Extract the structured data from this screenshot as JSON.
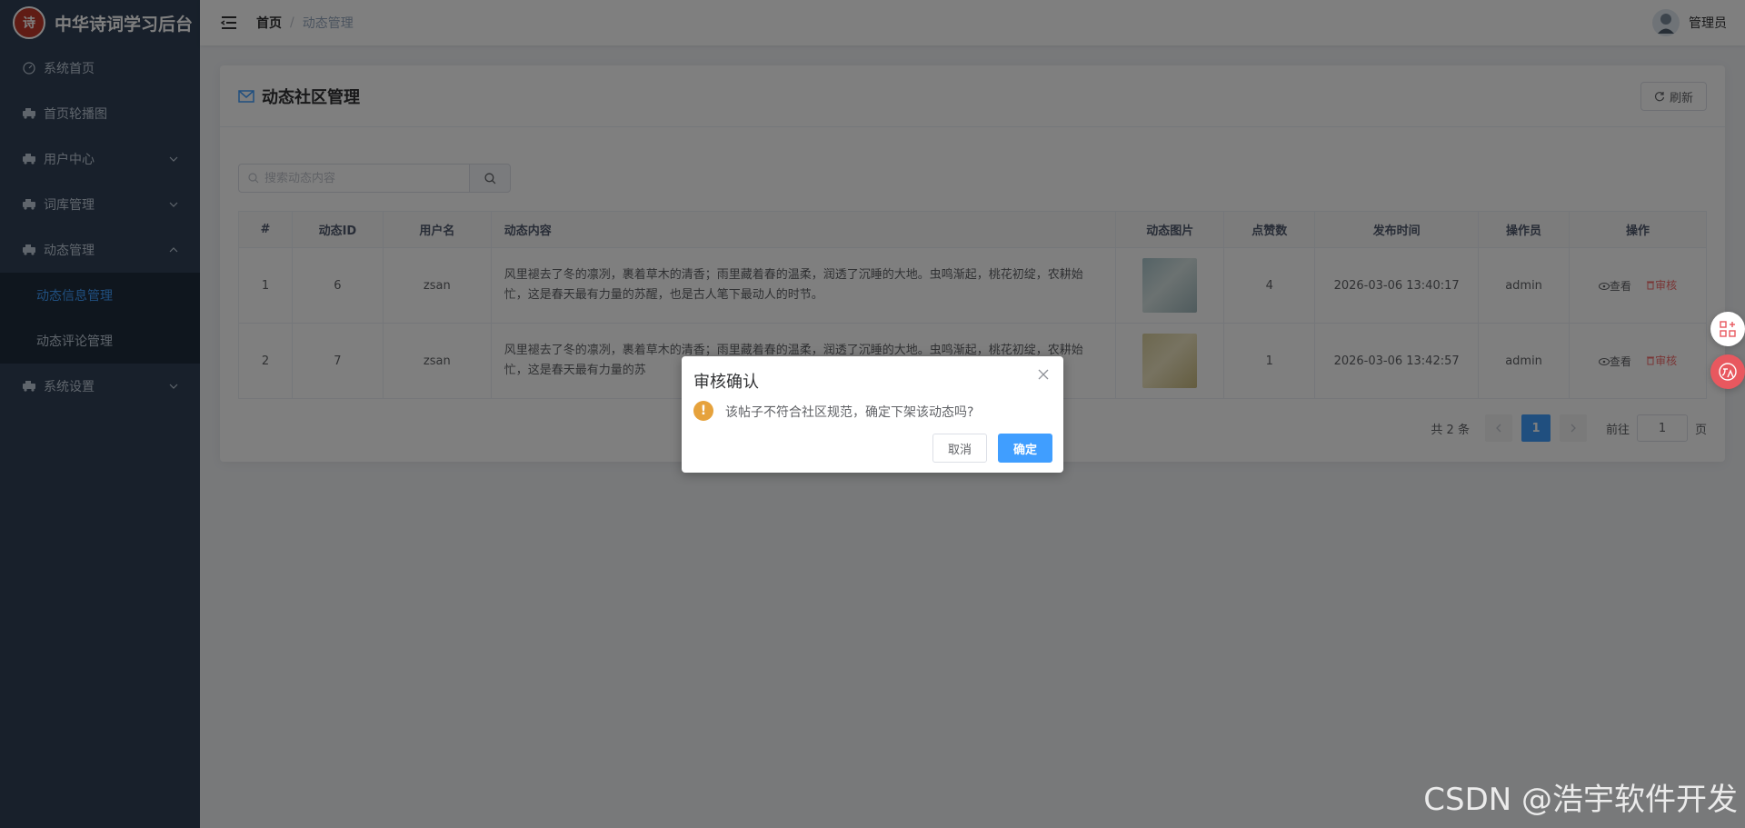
{
  "app": {
    "title": "中华诗词学习后台",
    "logo_text": "诗"
  },
  "sidebar": {
    "items": [
      {
        "label": "系统首页",
        "icon": "dashboard-icon"
      },
      {
        "label": "首页轮播图",
        "icon": "car-icon"
      },
      {
        "label": "用户中心",
        "icon": "car-icon",
        "expandable": true
      },
      {
        "label": "词库管理",
        "icon": "car-icon",
        "expandable": true
      },
      {
        "label": "动态管理",
        "icon": "car-icon",
        "expandable": true,
        "expanded": true
      },
      {
        "label": "系统设置",
        "icon": "car-icon",
        "expandable": true
      }
    ],
    "submenu": [
      {
        "label": "动态信息管理",
        "active": true
      },
      {
        "label": "动态评论管理",
        "active": false
      }
    ]
  },
  "header": {
    "breadcrumb_home": "首页",
    "breadcrumb_sep": "/",
    "breadcrumb_current": "动态管理",
    "username": "管理员"
  },
  "card": {
    "title": "动态社区管理",
    "refresh_label": "刷新",
    "search_placeholder": "搜索动态内容"
  },
  "table": {
    "headers": [
      "#",
      "动态ID",
      "用户名",
      "动态内容",
      "动态图片",
      "点赞数",
      "发布时间",
      "操作员",
      "操作"
    ],
    "rows": [
      {
        "index": "1",
        "id": "6",
        "username": "zsan",
        "content": "风里褪去了冬的凛冽，裹着草木的清香；雨里藏着春的温柔，润透了沉睡的大地。虫鸣渐起，桃花初绽，农耕始忙，这是春天最有力量的苏醒，也是古人笔下最动人的时节。",
        "likes": "4",
        "time": "2026-03-06 13:40:17",
        "operator": "admin"
      },
      {
        "index": "2",
        "id": "7",
        "username": "zsan",
        "content": "风里褪去了冬的凛冽，裹着草木的清香；雨里藏着春的温柔，润透了沉睡的大地。虫鸣渐起，桃花初绽，农耕始忙，这是春天最有力量的苏",
        "likes": "1",
        "time": "2026-03-06 13:42:57",
        "operator": "admin"
      }
    ],
    "view_label": "查看",
    "audit_label": "审核"
  },
  "pagination": {
    "total": "共 2 条",
    "current": "1",
    "goto_label": "前往",
    "goto_value": "1",
    "unit": "页"
  },
  "dialog": {
    "title": "审核确认",
    "icon_glyph": "!",
    "message": "该帖子不符合社区规范，确定下架该动态吗?",
    "cancel": "取消",
    "confirm": "确定"
  },
  "watermark": "CSDN @浩宇软件开发",
  "colors": {
    "sidebar": "#304156",
    "primary": "#409eff",
    "warning": "#e6a23c",
    "danger": "#f56c6c"
  }
}
